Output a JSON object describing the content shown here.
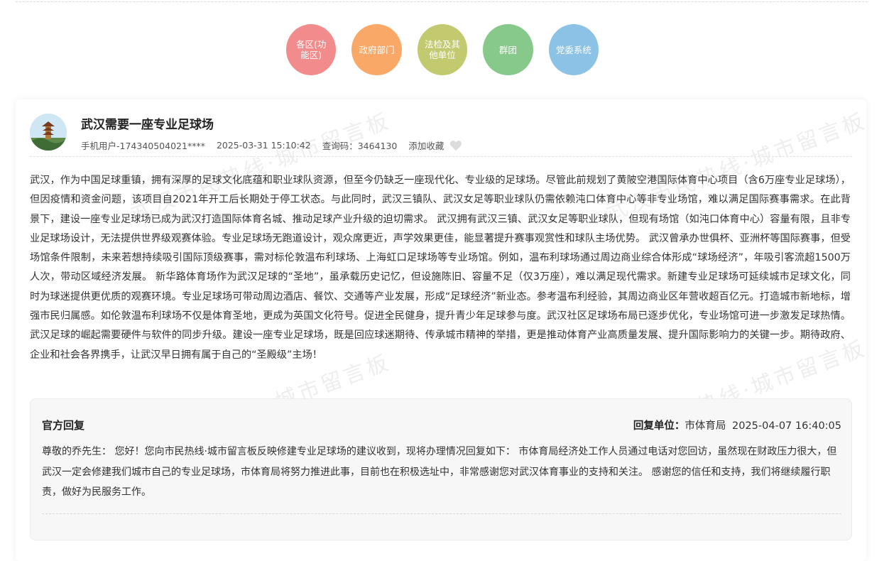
{
  "categories": [
    {
      "label": "各区(功能区)",
      "color": "#f28b8b"
    },
    {
      "label": "政府部门",
      "color": "#f9a868"
    },
    {
      "label": "法检及其他单位",
      "color": "#c3c96f"
    },
    {
      "label": "群团",
      "color": "#86c98a"
    },
    {
      "label": "党委系统",
      "color": "#8cc2e6"
    }
  ],
  "post": {
    "title": "武汉需要一座专业足球场",
    "author": "手机用户-174340504021****",
    "datetime": "2025-03-31 15:10:42",
    "query_code": "查询码：3464130",
    "favorite_label": "添加收藏",
    "body": "武汉，作为中国足球重镇，拥有深厚的足球文化底蕴和职业球队资源，但至今仍缺乏一座现代化、专业级的足球场。尽管此前规划了黄陂空港国际体育中心项目（含6万座专业足球场），但因疫情和资金问题，该项目自2021年开工后长期处于停工状态。与此同时，武汉三镇队、武汉女足等职业球队仍需依赖沌口体育中心等非专业场馆，难以满足国际赛事需求。在此背景下，建设一座专业足球场已成为武汉打造国际体育名城、推动足球产业升级的迫切需求。 武汉拥有武汉三镇、武汉女足等职业球队，但现有场馆（如沌口体育中心）容量有限，且非专业足球场设计，无法提供世界级观赛体验。专业足球场无跑道设计，观众席更近，声学效果更佳，能显著提升赛事观赏性和球队主场优势。 武汉曾承办世俱杯、亚洲杯等国际赛事，但受场馆条件限制，未来若想持续吸引国际顶级赛事，需对标伦敦温布利球场、上海虹口足球场等专业场馆。例如，温布利球场通过周边商业综合体形成“球场经济”，年吸引客流超1500万人次，带动区域经济发展。 新华路体育场作为武汉足球的“圣地”，虽承载历史记忆，但设施陈旧、容量不足（仅3万座），难以满足现代需求。新建专业足球场可延续城市足球文化，同时为球迷提供更优质的观赛环境。专业足球场可带动周边酒店、餐饮、交通等产业发展，形成“足球经济”新业态。参考温布利经验，其周边商业区年营收超百亿元。打造城市新地标，增强市民归属感。如伦敦温布利球场不仅是体育圣地，更成为英国文化符号。促进全民健身，提升青少年足球参与度。武汉社区足球场布局已逐步优化，专业场馆可进一步激发足球热情。武汉足球的崛起需要硬件与软件的同步升级。建设一座专业足球场，既是回应球迷期待、传承城市精神的举措，更是推动体育产业高质量发展、提升国际影响力的关键一步。期待政府、企业和社会各界携手，让武汉早日拥有属于自己的“圣殿级”主场！"
  },
  "reply": {
    "title": "官方回复",
    "unit_label": "回复单位：",
    "unit": "市体育局",
    "datetime": "2025-04-07 16:40:05",
    "body": "尊敬的乔先生： 您好！您向市民热线·城市留言板反映修建专业足球场的建议收到，现将办理情况回复如下： 市体育局经济处工作人员通过电话对您回访，虽然现在财政压力很大，但武汉一定会修建我们城市自己的专业足球场，市体育局将努力推进此事，目前也在积极选址中，非常感谢您对武汉体育事业的支持和关注。 感谢您的信任和支持，我们将继续履行职责，做好为民服务工作。"
  },
  "watermark": {
    "text": "武汉市民热线·城市留言板"
  },
  "icons": {
    "heart": "heart-icon",
    "avatar": "avatar"
  }
}
